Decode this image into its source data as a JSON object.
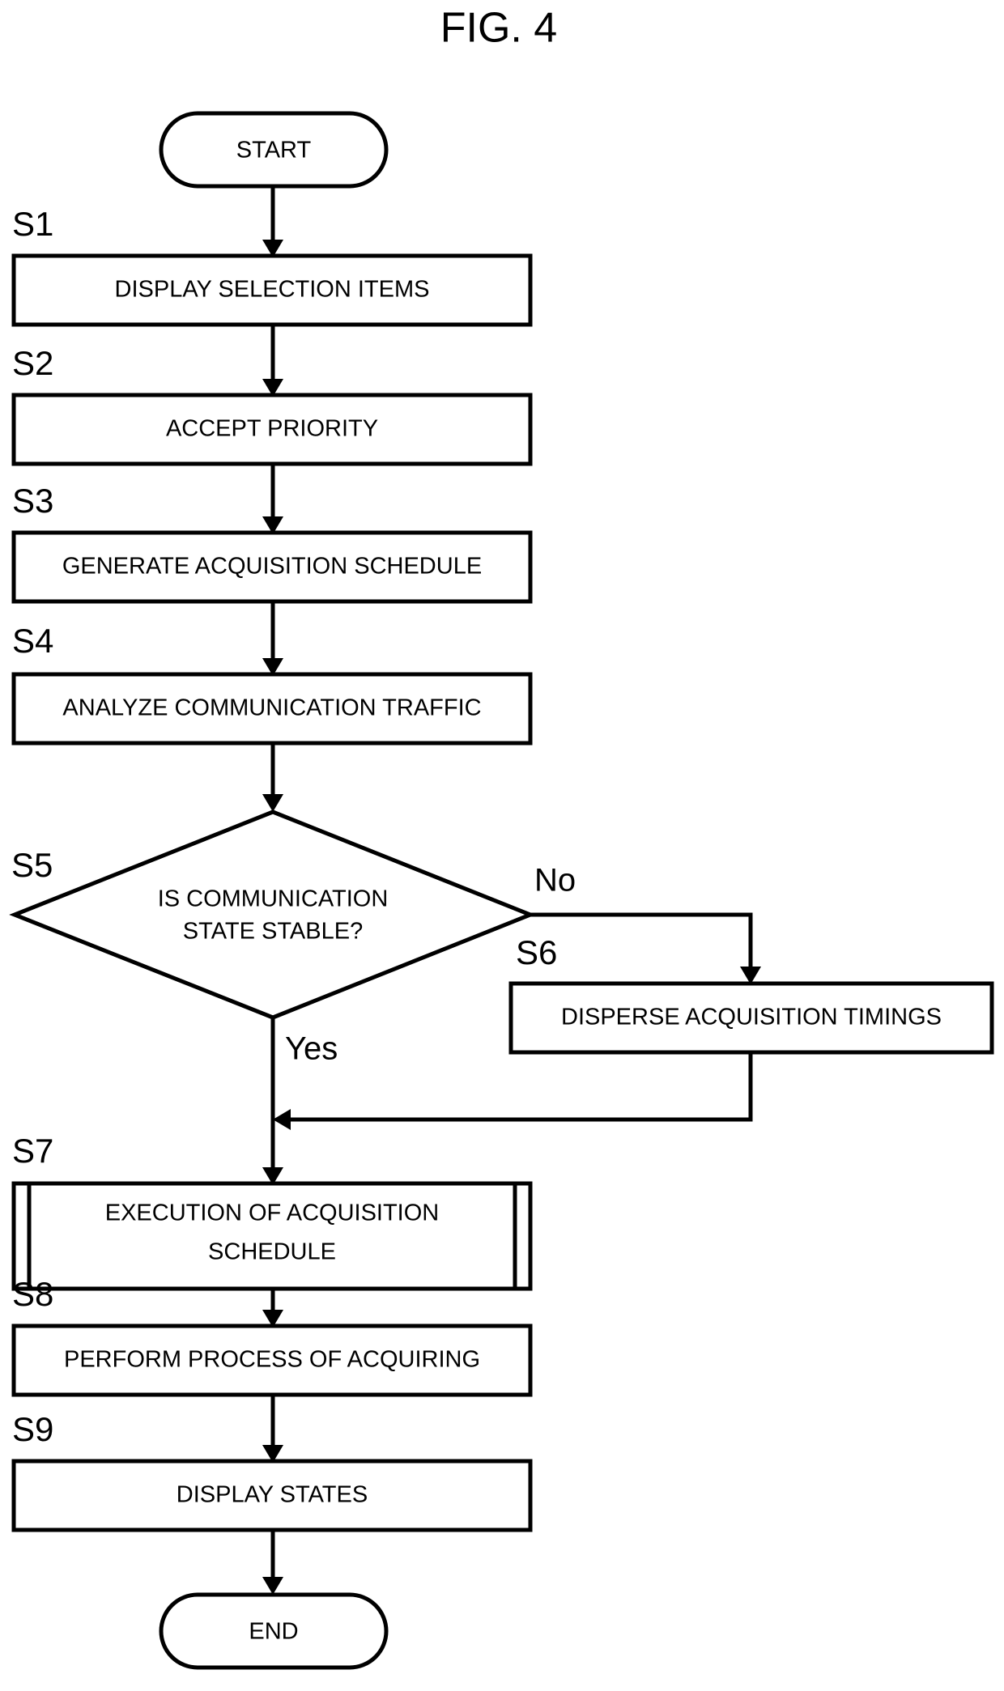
{
  "figure": {
    "title": "FIG. 4",
    "type": "flowchart"
  },
  "nodes": {
    "start": {
      "label": "START",
      "shape": "terminator"
    },
    "end": {
      "label": "END",
      "shape": "terminator"
    },
    "s1": {
      "step": "S1",
      "label": "DISPLAY SELECTION ITEMS",
      "shape": "process"
    },
    "s2": {
      "step": "S2",
      "label": "ACCEPT PRIORITY",
      "shape": "process"
    },
    "s3": {
      "step": "S3",
      "label": "GENERATE ACQUISITION SCHEDULE",
      "shape": "process"
    },
    "s4": {
      "step": "S4",
      "label": "ANALYZE COMMUNICATION TRAFFIC",
      "shape": "process"
    },
    "s5": {
      "step": "S5",
      "label_line1": "IS COMMUNICATION",
      "label_line2": "STATE STABLE?",
      "shape": "decision"
    },
    "s6": {
      "step": "S6",
      "label": "DISPERSE ACQUISITION TIMINGS",
      "shape": "process"
    },
    "s7": {
      "step": "S7",
      "label_line1": "EXECUTION OF ACQUISITION",
      "label_line2": "SCHEDULE",
      "shape": "predefined-process"
    },
    "s8": {
      "step": "S8",
      "label": "PERFORM PROCESS OF ACQUIRING",
      "shape": "process"
    },
    "s9": {
      "step": "S9",
      "label": "DISPLAY STATES",
      "shape": "process"
    }
  },
  "branches": {
    "yes": "Yes",
    "no": "No"
  },
  "colors": {
    "stroke": "#000000",
    "fill": "#ffffff",
    "text": "#000000"
  }
}
